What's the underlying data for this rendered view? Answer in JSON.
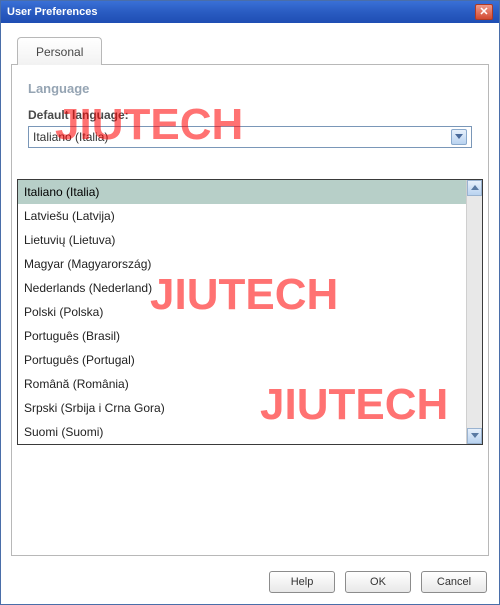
{
  "titlebar": {
    "title": "User Preferences",
    "close_glyph": "✕"
  },
  "tabs": {
    "personal": "Personal"
  },
  "section": {
    "language_heading": "Language",
    "default_language_label": "Default language:"
  },
  "combo": {
    "selected_value": "Italiano (Italia)"
  },
  "dropdown": {
    "items": [
      "Italiano (Italia)",
      "Latviešu (Latvija)",
      "Lietuvių (Lietuva)",
      "Magyar (Magyarország)",
      "Nederlands (Nederland)",
      "Polski (Polska)",
      "Português (Brasil)",
      "Português (Portugal)",
      "Română (România)",
      "Srpski (Srbija i Crna Gora)",
      "Suomi (Suomi)"
    ],
    "selected_index": 0
  },
  "buttons": {
    "help": "Help",
    "ok": "OK",
    "cancel": "Cancel"
  },
  "watermark": "JIUTECH"
}
